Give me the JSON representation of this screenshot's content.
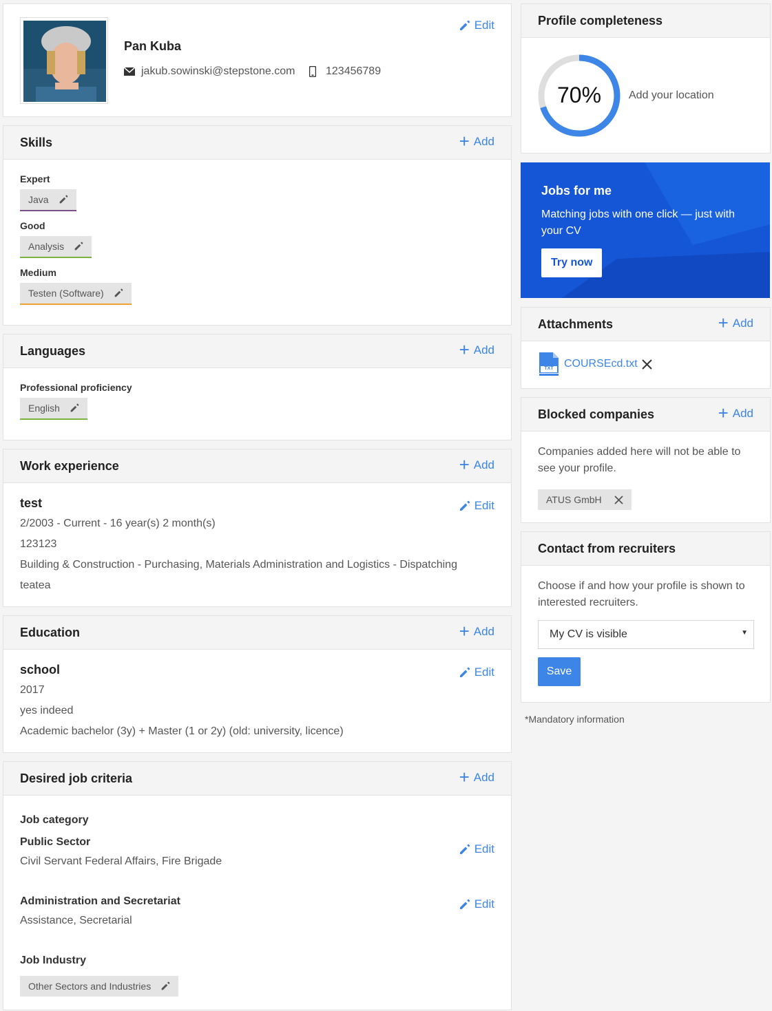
{
  "profile": {
    "name": "Pan Kuba",
    "email": "jakub.sowinski@stepstone.com",
    "phone": "123456789",
    "edit_label": "Edit"
  },
  "skills": {
    "title": "Skills",
    "add_label": "Add",
    "groups": [
      {
        "level": "Expert",
        "skill": "Java",
        "color": "#7a4f8a"
      },
      {
        "level": "Good",
        "skill": "Analysis",
        "color": "#7bb43d"
      },
      {
        "level": "Medium",
        "skill": "Testen (Software)",
        "color": "#f0a030"
      }
    ]
  },
  "languages": {
    "title": "Languages",
    "add_label": "Add",
    "level": "Professional proficiency",
    "language": "English",
    "color": "#7bb43d"
  },
  "work": {
    "title": "Work experience",
    "add_label": "Add",
    "edit_label": "Edit",
    "position": "test",
    "period": "2/2003 - Current - 16 year(s) 2 month(s)",
    "company": "123123",
    "category": "Building & Construction - Purchasing, Materials Administration and Logistics - Dispatching",
    "description": "teatea"
  },
  "education": {
    "title": "Education",
    "add_label": "Add",
    "edit_label": "Edit",
    "school": "school",
    "year": "2017",
    "subject": "yes indeed",
    "degree": "Academic bachelor (3y) + Master (1 or 2y) (old: university, licence)"
  },
  "criteria": {
    "title": "Desired job criteria",
    "add_label": "Add",
    "edit_label": "Edit",
    "category_label": "Job category",
    "categories": [
      {
        "name": "Public Sector",
        "detail": "Civil Servant Federal Affairs, Fire Brigade"
      },
      {
        "name": "Administration and Secretariat",
        "detail": "Assistance, Secretarial"
      }
    ],
    "industry_label": "Job Industry",
    "industry": "Other Sectors and Industries"
  },
  "completeness": {
    "title": "Profile completeness",
    "percent_label": "70%",
    "percent": 70,
    "hint": "Add your location",
    "accent": "#3d85e6"
  },
  "jobs": {
    "title": "Jobs for me",
    "text": "Matching jobs with one click — just with your CV",
    "button": "Try now",
    "bg": "#1556d6"
  },
  "attachments": {
    "title": "Attachments",
    "add_label": "Add",
    "file": "COURSEcd.txt",
    "file_type": "TXT"
  },
  "blocked": {
    "title": "Blocked companies",
    "add_label": "Add",
    "text": "Companies added here will not be able to see your profile.",
    "company": "ATUS GmbH"
  },
  "recruiters": {
    "title": "Contact from recruiters",
    "text": "Choose if and how your profile is shown to interested recruiters.",
    "select_value": "My CV is visible",
    "save_label": "Save"
  },
  "mandatory": "*Mandatory information"
}
